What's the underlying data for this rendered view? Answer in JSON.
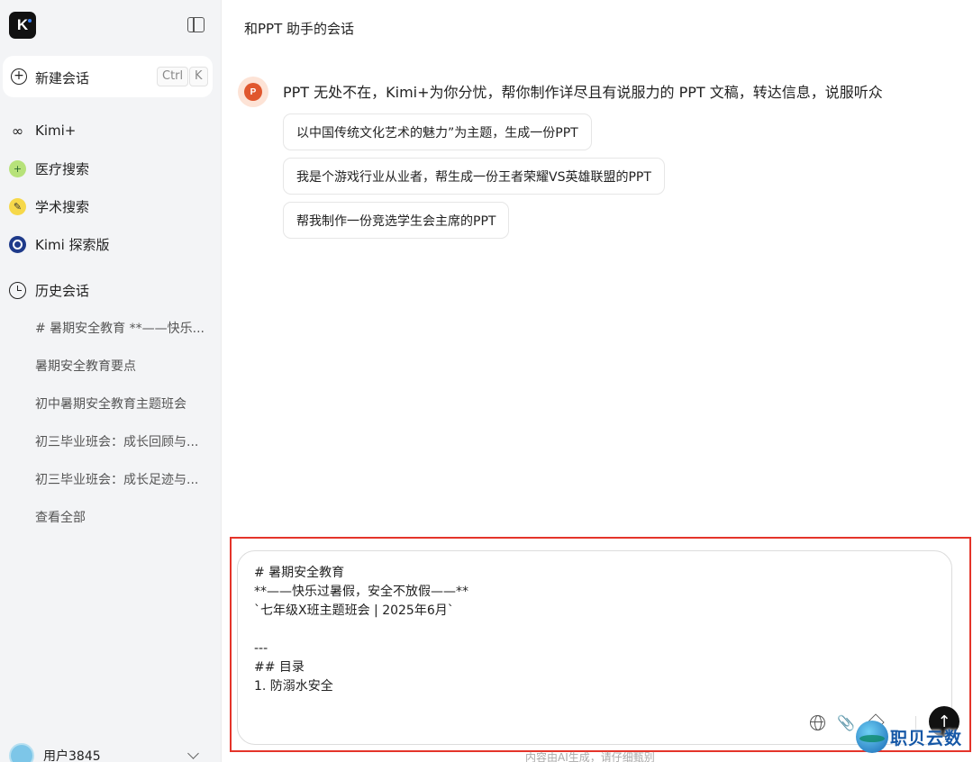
{
  "sidebar": {
    "logo_letter": "K",
    "new_chat": {
      "label": "新建会话",
      "shortcut_ctrl": "Ctrl",
      "shortcut_key": "K"
    },
    "nav": [
      {
        "label": "Kimi+",
        "icon": "kimi-plus-icon"
      },
      {
        "label": "医疗搜索",
        "icon": "medical-search-icon"
      },
      {
        "label": "学术搜索",
        "icon": "academic-search-icon"
      },
      {
        "label": "Kimi 探索版",
        "icon": "explore-icon"
      }
    ],
    "history": {
      "title": "历史会话",
      "items": [
        "# 暑期安全教育 **——快乐...",
        "暑期安全教育要点",
        "初中暑期安全教育主题班会",
        "初三毕业班会：成长回顾与...",
        "初三毕业班会：成长足迹与..."
      ],
      "view_all": "查看全部"
    },
    "user": {
      "name": "用户3845"
    }
  },
  "main": {
    "title": "和PPT 助手的会话",
    "assistant_intro": "PPT 无处不在，Kimi+为你分忧，帮你制作详尽且有说服力的 PPT 文稿，转达信息，说服听众",
    "suggestions": [
      "以中国传统文化艺术的魅力”为主题，生成一份PPT",
      "我是个游戏行业从业者，帮生成一份王者荣耀VS英雄联盟的PPT",
      "帮我制作一份竞选学生会主席的PPT"
    ],
    "input": {
      "value": "# 暑期安全教育\n**——快乐过暑假，安全不放假——**\n`七年级X班主题班会 | 2025年6月`\n\n---\n## 目录\n1. 防溺水安全"
    },
    "disclaimer": "内容由AI生成，请仔细甄别"
  },
  "watermark": {
    "text": "职贝云数"
  },
  "colors": {
    "highlight_border": "#e4342a",
    "sidebar_bg": "#f3f4f6",
    "send_button": "#111111"
  }
}
